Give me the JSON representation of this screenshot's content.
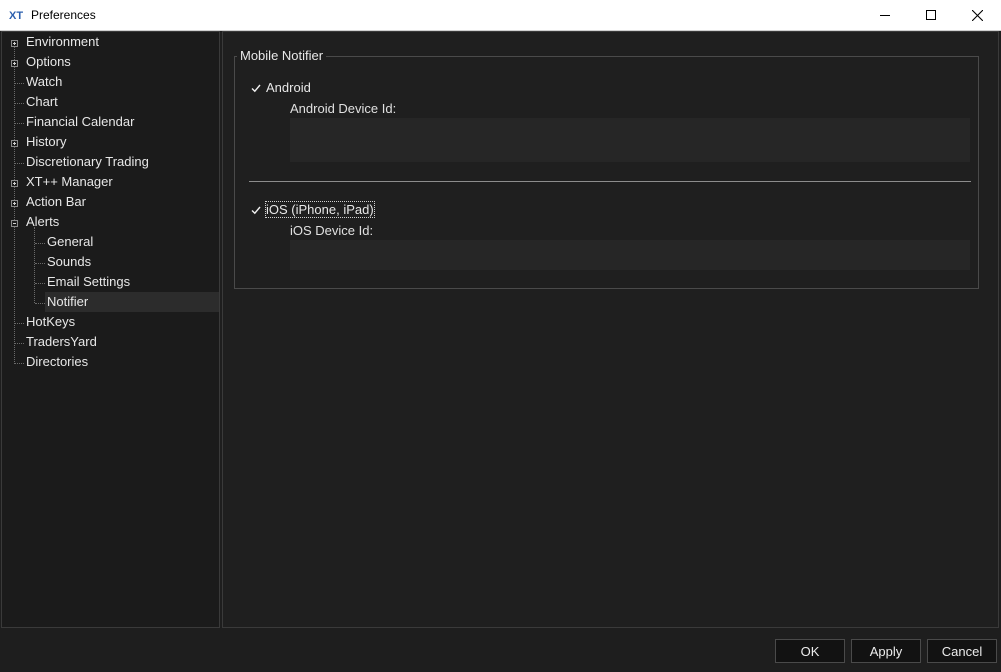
{
  "window": {
    "title": "Preferences"
  },
  "tree": {
    "items": [
      {
        "label": "Environment",
        "expander": "plus"
      },
      {
        "label": "Options",
        "expander": "plus"
      },
      {
        "label": "Watch",
        "expander": "none"
      },
      {
        "label": "Chart",
        "expander": "none"
      },
      {
        "label": "Financial Calendar",
        "expander": "none"
      },
      {
        "label": "History",
        "expander": "plus"
      },
      {
        "label": "Discretionary Trading",
        "expander": "none"
      },
      {
        "label": "XT++ Manager",
        "expander": "plus"
      },
      {
        "label": "Action Bar",
        "expander": "plus"
      },
      {
        "label": "Alerts",
        "expander": "minus",
        "children": [
          {
            "label": "General"
          },
          {
            "label": "Sounds"
          },
          {
            "label": "Email Settings"
          },
          {
            "label": "Notifier",
            "selected": true
          }
        ]
      },
      {
        "label": "HotKeys",
        "expander": "none"
      },
      {
        "label": "TradersYard",
        "expander": "none"
      },
      {
        "label": "Directories",
        "expander": "none"
      }
    ]
  },
  "notifier": {
    "group_title": "Mobile Notifier",
    "android": {
      "label": "Android",
      "checked": true,
      "field_label": "Android Device Id:",
      "value": ""
    },
    "ios": {
      "label": "iOS (iPhone, iPad)",
      "checked": true,
      "field_label": "iOS Device Id:",
      "value": ""
    }
  },
  "buttons": {
    "ok": "OK",
    "apply": "Apply",
    "cancel": "Cancel"
  },
  "colors": {
    "background": "#1e1e1e",
    "panel": "#1f1f1f",
    "field": "#262626",
    "selected_row": "#2c2c2c"
  }
}
